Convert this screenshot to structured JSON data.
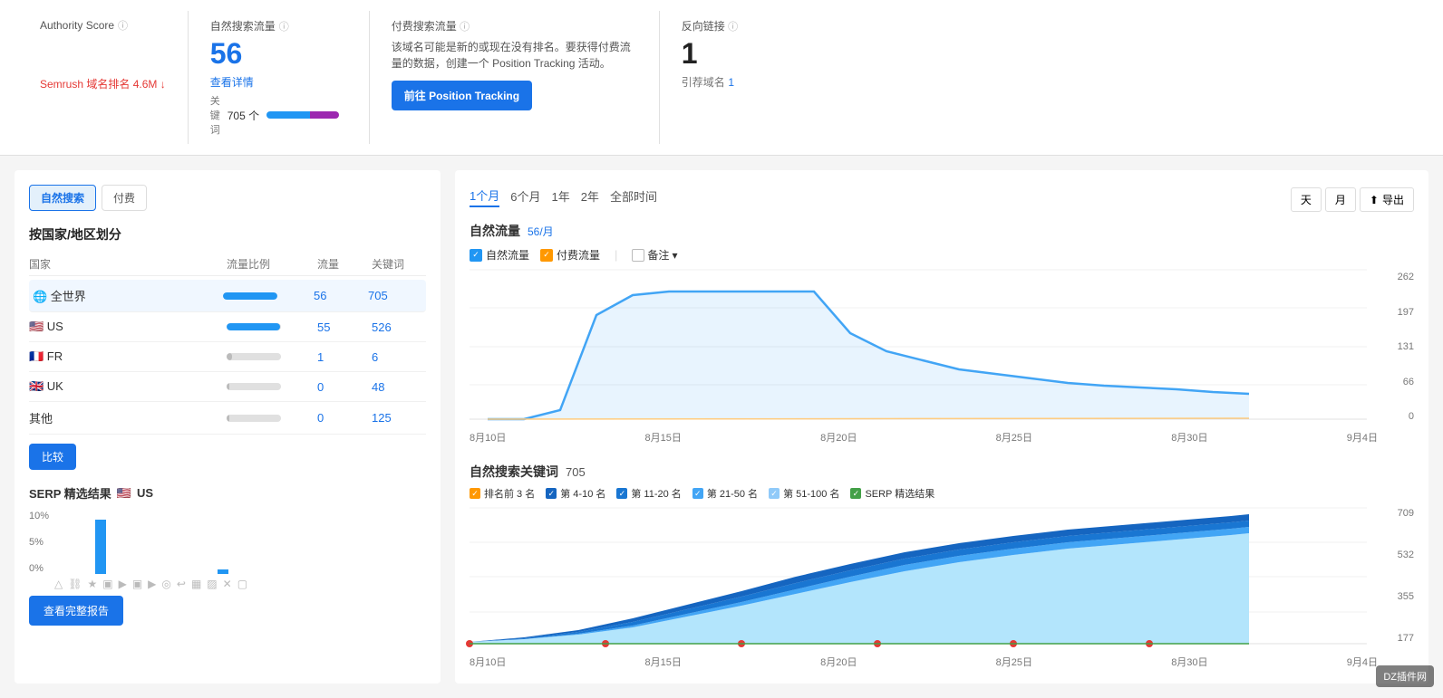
{
  "header": {
    "authority_score_label": "Authority Score",
    "organic_traffic_label": "自然搜索流量",
    "organic_traffic_value": "56",
    "organic_traffic_link": "查看详情",
    "keyword_label": "关键词",
    "keyword_count": "705 个",
    "paid_traffic_label": "付费搜索流量",
    "paid_traffic_description": "该域名可能是新的或现在没有排名。要获得付费流量的数据，创建一个 Position Tracking 活动。",
    "paid_traffic_btn": "前往 Position Tracking",
    "backlinks_label": "反向链接",
    "backlinks_value": "1",
    "referring_label": "引荐域名",
    "referring_link": "1",
    "semrush_rank_label": "Semrush 域名排名",
    "semrush_rank_value": "4.6M",
    "semrush_rank_arrow": "↓"
  },
  "left_panel": {
    "tab_organic": "自然搜索",
    "tab_paid": "付费",
    "section_title": "按国家/地区划分",
    "col_country": "国家",
    "col_traffic_ratio": "流量比例",
    "col_traffic": "流量",
    "col_keywords": "关键词",
    "rows": [
      {
        "name": "全世界",
        "flag": "world",
        "ratio": "100%",
        "traffic": "56",
        "keywords": "705",
        "bar_width": "100",
        "highlighted": true
      },
      {
        "name": "US",
        "flag": "us",
        "ratio": "98%",
        "traffic": "55",
        "keywords": "526",
        "bar_width": "98",
        "highlighted": false
      },
      {
        "name": "FR",
        "flag": "fr",
        "ratio": "1.8%",
        "traffic": "1",
        "keywords": "6",
        "bar_width": "10",
        "highlighted": false
      },
      {
        "name": "UK",
        "flag": "uk",
        "ratio": "<0.1%",
        "traffic": "0",
        "keywords": "48",
        "bar_width": "5",
        "highlighted": false
      },
      {
        "name": "其他",
        "flag": "other",
        "ratio": "<0.1%",
        "traffic": "0",
        "keywords": "125",
        "bar_width": "5",
        "highlighted": false
      }
    ],
    "compare_btn": "比较",
    "serp_title": "SERP 精选结果",
    "serp_flag": "US",
    "serp_y_labels": [
      "10%",
      "5%",
      "0%"
    ],
    "serp_icons": [
      "△",
      "⛓",
      "★",
      "▣",
      "▶",
      "▣",
      "▶",
      "◎",
      "↩",
      "▦",
      "▨",
      "✕",
      "▢"
    ],
    "view_report_btn": "查看完整报告"
  },
  "right_panel": {
    "time_tabs": [
      "1个月",
      "6个月",
      "1年",
      "2年",
      "全部时间"
    ],
    "active_time_tab": "1个月",
    "view_btn_day": "天",
    "view_btn_month": "月",
    "export_btn": "导出",
    "chart_title": "自然流量",
    "chart_value": "56/月",
    "legend_organic": "自然流量",
    "legend_paid": "付费流量",
    "legend_notes": "备注",
    "chart_y_labels": [
      "262",
      "197",
      "131",
      "66",
      "0"
    ],
    "chart_x_labels": [
      "8月10日",
      "8月15日",
      "8月20日",
      "8月25日",
      "8月30日",
      "9月4日"
    ],
    "keywords_title": "自然搜索关键词",
    "keywords_count": "705",
    "kw_legend": [
      {
        "label": "排名前 3 名",
        "color": "orange"
      },
      {
        "label": "第 4-10 名",
        "color": "blue1"
      },
      {
        "label": "第 11-20 名",
        "color": "blue2"
      },
      {
        "label": "第 21-50 名",
        "color": "blue3"
      },
      {
        "label": "第 51-100 名",
        "color": "blue4"
      },
      {
        "label": "SERP 精选结果",
        "color": "green"
      }
    ],
    "kw_y_labels": [
      "709",
      "532",
      "355",
      "177"
    ],
    "kw_x_labels": [
      "8月10日",
      "8月15日",
      "8月20日",
      "8月25日",
      "8月30日",
      "9月4日"
    ]
  },
  "watermark": "DZ插件网"
}
